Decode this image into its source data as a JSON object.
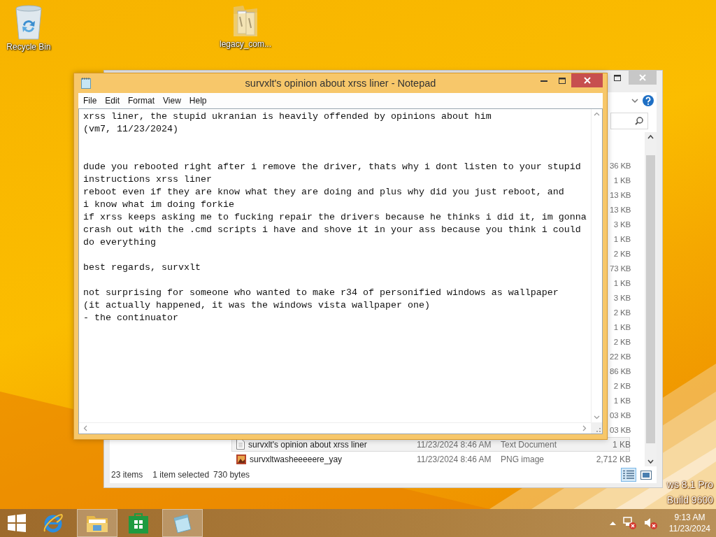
{
  "desktop": {
    "icons": [
      {
        "label": "Recycle Bin",
        "kind": "recycle-bin"
      },
      {
        "label": "legacy_com...",
        "kind": "folder"
      }
    ],
    "watermark_lines": [
      "ws 8.1 Pro",
      "Build 9600"
    ]
  },
  "explorer": {
    "rows": [
      {
        "size": "36 KB",
        "selected": false
      },
      {
        "size": "1 KB",
        "selected": false
      },
      {
        "size": "13 KB",
        "selected": false
      },
      {
        "size": "13 KB",
        "selected": false
      },
      {
        "size": "3 KB",
        "selected": false
      },
      {
        "size": "1 KB",
        "selected": false
      },
      {
        "size": "2 KB",
        "selected": false
      },
      {
        "size": "73 KB",
        "selected": false
      },
      {
        "size": "1 KB",
        "selected": false
      },
      {
        "size": "3 KB",
        "selected": false
      },
      {
        "size": "2 KB",
        "selected": false
      },
      {
        "size": "1 KB",
        "selected": false
      },
      {
        "size": "2 KB",
        "selected": false
      },
      {
        "size": "22 KB",
        "selected": false
      },
      {
        "size": "86 KB",
        "selected": false
      },
      {
        "size": "2 KB",
        "selected": false
      },
      {
        "size": "1 KB",
        "selected": false
      },
      {
        "size": "03 KB",
        "selected": false
      },
      {
        "size": "03 KB",
        "selected": false
      },
      {
        "name": "survxlt's opinion about xrss liner",
        "date": "11/23/2024 8:46 AM",
        "type": "Text Document",
        "size": "1 KB",
        "kind": "text",
        "selected": true
      },
      {
        "name": "survxltwasheeeeere_yay",
        "date": "11/23/2024 8:46 AM",
        "type": "PNG image",
        "size": "2,712 KB",
        "kind": "image",
        "selected": false
      }
    ],
    "status": {
      "count": "23 items",
      "selection": "1 item selected",
      "size": "730 bytes"
    }
  },
  "notepad": {
    "title": "survxlt's opinion about xrss liner - Notepad",
    "menu": [
      "File",
      "Edit",
      "Format",
      "View",
      "Help"
    ],
    "text": "xrss liner, the stupid ukranian is heavily offended by opinions about him\n(vm7, 11/23/2024)\n\n\ndude you rebooted right after i remove the driver, thats why i dont listen to your stupid instructions xrss liner\nreboot even if they are know what they are doing and plus why did you just reboot, and\ni know what im doing forkie\nif xrss keeps asking me to fucking repair the drivers because he thinks i did it, im gonna crash out with the .cmd scripts i have and shove it in your ass because you think i could do everything\n\nbest regards, survxlt\n\nnot surprising for someone who wanted to make r34 of personified windows as wallpaper\n(it actually happened, it was the windows vista wallpaper one)\n- the continuator"
  },
  "taskbar": {
    "apps": [
      {
        "kind": "start",
        "running": false
      },
      {
        "kind": "browser",
        "running": false
      },
      {
        "kind": "explorer",
        "running": true
      },
      {
        "kind": "store",
        "running": false
      },
      {
        "kind": "notepad",
        "running": true
      }
    ],
    "time": "9:13 AM",
    "date": "11/23/2024"
  }
}
